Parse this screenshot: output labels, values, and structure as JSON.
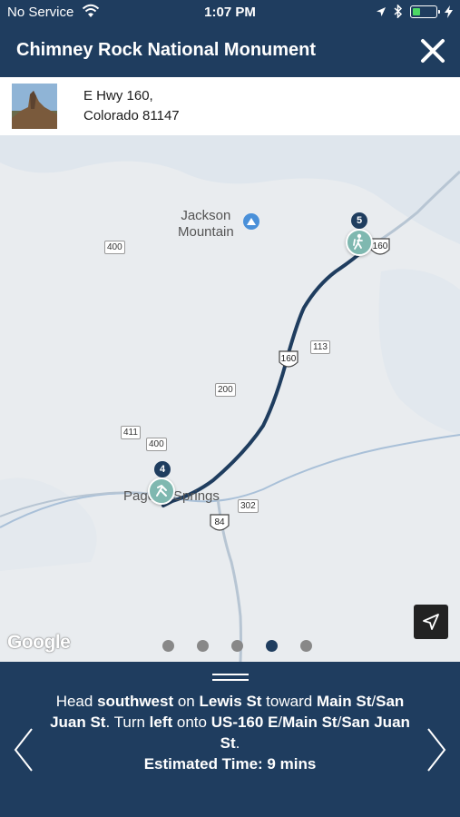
{
  "status_bar": {
    "carrier": "No Service",
    "time": "1:07 PM",
    "battery_level": 0.35
  },
  "header": {
    "title": "Chimney Rock National Monument"
  },
  "info": {
    "address_line1": "E Hwy 160,",
    "address_line2": "Colorado 81147"
  },
  "map": {
    "place_label_line1": "Jackson",
    "place_label_line2": "Mountain",
    "town_label": "Pagosa Springs",
    "roads": [
      "400",
      "400",
      "411",
      "200",
      "113",
      "302"
    ],
    "us_routes": [
      "160",
      "160",
      "84"
    ],
    "markers": [
      "5",
      "4"
    ],
    "logo": "Google",
    "page_count": 5,
    "active_page": 4
  },
  "panel": {
    "d1": "Head ",
    "d2": "southwest",
    "d3": " on ",
    "d4": "Lewis St",
    "d5": " toward ",
    "d6": "Main St",
    "d7": "/",
    "d8": "San Juan St",
    "d9": ". Turn ",
    "d10": "left",
    "d11": " onto ",
    "d12": "US-160 E",
    "d13": "/",
    "d14": "Main St",
    "d15": "/",
    "d16": "San Juan St",
    "d17": ".",
    "estimated": "Estimated Time: 9 mins"
  },
  "colors": {
    "brand": "#1f3d5f",
    "route": "#1f3d5f",
    "marker": "#7fb8b0"
  }
}
